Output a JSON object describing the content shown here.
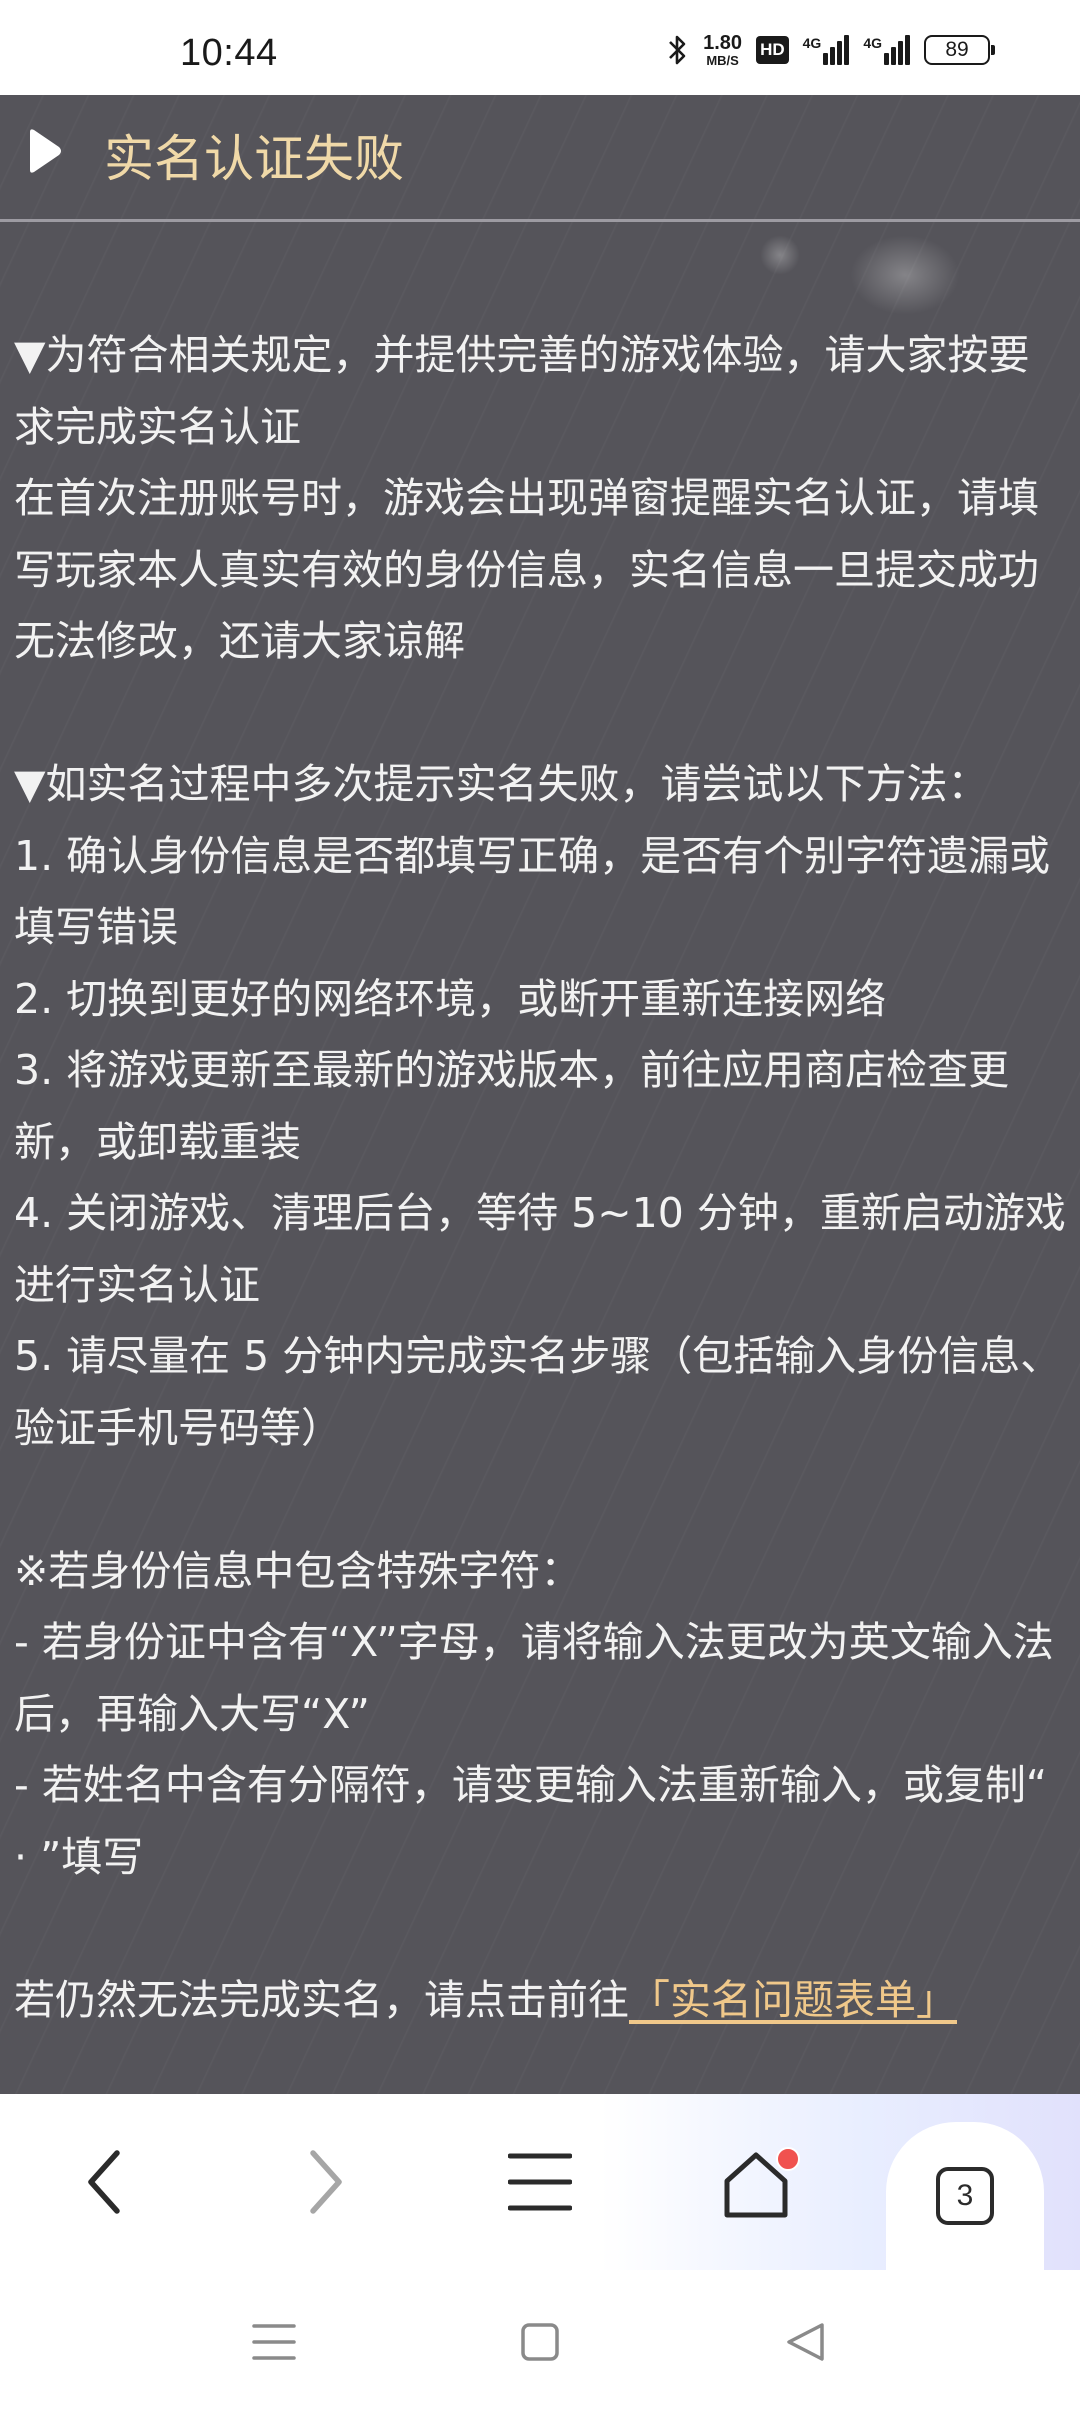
{
  "status_bar": {
    "time": "10:44",
    "net_speed_value": "1.80",
    "net_speed_unit": "MB/S",
    "hd_label": "HD",
    "sim1_tag": "4G",
    "sim2_tag": "4G",
    "battery_level": "89"
  },
  "header": {
    "icon": "play-triangle-icon",
    "title": "实名认证失败",
    "title_color": "#f0d9a8"
  },
  "article": {
    "section1_line1": "▼为符合相关规定，并提供完善的游戏体验，请大家按要求完成实名认证",
    "section1_line2": "在首次注册账号时，游戏会出现弹窗提醒实名认证，请填写玩家本人真实有效的身份信息，实名信息一旦提交成功无法修改，还请大家谅解",
    "section2_heading": "▼如实名过程中多次提示实名失败，请尝试以下方法：",
    "steps": [
      "1. 确认身份信息是否都填写正确，是否有个别字符遗漏或填写错误",
      "2. 切换到更好的网络环境，或断开重新连接网络",
      "3. 将游戏更新至最新的游戏版本，前往应用商店检查更新，或卸载重装",
      "4. 关闭游戏、清理后台，等待 5~10 分钟，重新启动游戏进行实名认证",
      "5. 请尽量在 5 分钟内完成实名步骤（包括输入身份信息、验证手机号码等）"
    ],
    "special_heading": "※若身份信息中包含特殊字符：",
    "special_items": [
      "- 若身份证中含有“X”字母，请将输入法更改为英文输入法后，再输入大写“X”",
      "- 若姓名中含有分隔符，请变更输入法重新输入，或复制“ · ”填写"
    ],
    "closing_prefix": "若仍然无法完成实名，请点击前往",
    "closing_link": "「实名问题表单」",
    "link_color": "#f0c88a"
  },
  "toolbar": {
    "back_icon": "chevron-left-icon",
    "forward_icon": "chevron-right-icon",
    "menu_icon": "hamburger-menu-icon",
    "home_icon": "home-icon",
    "tab_count": "3",
    "notification_color": "#f0524f"
  },
  "system_nav": {
    "recents_icon": "recents-icon",
    "home_icon": "square-home-icon",
    "back_icon": "triangle-back-icon"
  },
  "colors": {
    "panel_background": "#55545a",
    "body_text": "#f2f2f2"
  }
}
